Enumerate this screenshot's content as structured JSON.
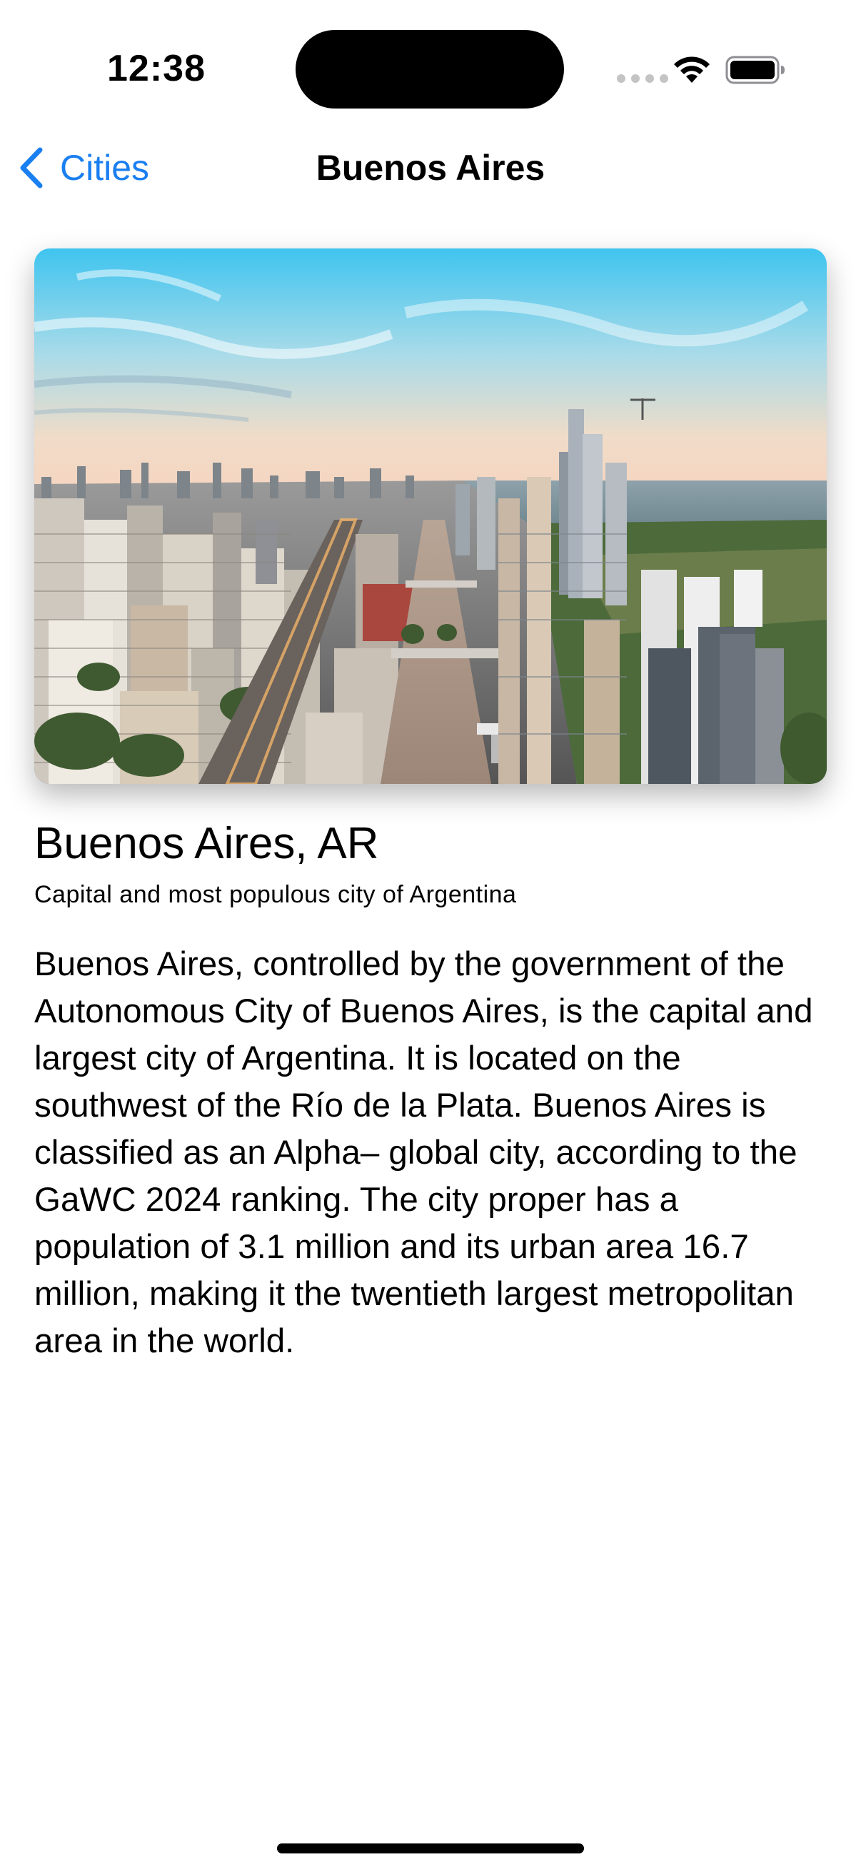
{
  "status_bar": {
    "time": "12:38"
  },
  "nav": {
    "back_label": "Cities",
    "title": "Buenos Aires"
  },
  "city": {
    "name": "Buenos Aires, AR",
    "subtitle": "Capital and most populous city of Argentina",
    "description": "Buenos Aires, controlled by the government of the Autonomous City of Buenos Aires, is the capital and largest city of Argentina. It is located on the southwest of the Río de la Plata. Buenos Aires is classified as an Alpha– global city, according to the GaWC 2024 ranking. The city proper has a population of 3.1 million and its urban area 16.7 million, making it the twentieth largest metropolitan area in the world."
  },
  "icons": {
    "back": "chevron-left-icon",
    "wifi": "wifi-icon",
    "battery": "battery-icon",
    "signal": "cellular-signal-icon"
  },
  "colors": {
    "accent": "#1a7ff0",
    "background": "#ffffff",
    "text": "#000000"
  }
}
